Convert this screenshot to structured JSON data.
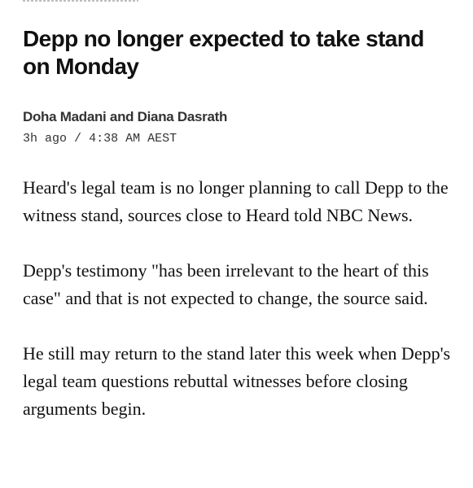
{
  "article": {
    "headline": "Depp no longer expected to take stand on Monday",
    "byline": "Doha Madani and Diana Dasrath",
    "time_ago": "3h ago",
    "time_separator": "/",
    "time_exact": "4:38 AM AEST",
    "paragraphs": [
      "Heard's legal team is no longer planning to call Depp to the witness stand, sources close to Heard told NBC News.",
      "Depp's testimony \"has been irrelevant to the heart of this case\" and that is not expected to change, the source said.",
      "He still may return to the stand later this week when Depp's legal team questions rebuttal witnesses before closing arguments begin."
    ]
  }
}
